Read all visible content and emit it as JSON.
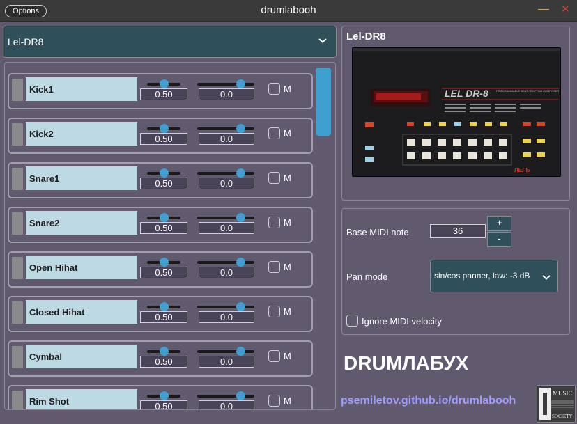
{
  "window": {
    "title": "drumlabooh",
    "options_label": "Options",
    "minimize_glyph": "—",
    "close_glyph": "✕"
  },
  "preset": {
    "selected": "Lel-DR8"
  },
  "drums": [
    {
      "name": "Kick1",
      "level": "0.50",
      "pan": "0.0",
      "mute_label": "M",
      "level_fraction": 0.5,
      "pan_fraction": 0.75
    },
    {
      "name": "Kick2",
      "level": "0.50",
      "pan": "0.0",
      "mute_label": "M",
      "level_fraction": 0.5,
      "pan_fraction": 0.75
    },
    {
      "name": "Snare1",
      "level": "0.50",
      "pan": "0.0",
      "mute_label": "M",
      "level_fraction": 0.5,
      "pan_fraction": 0.75
    },
    {
      "name": "Snare2",
      "level": "0.50",
      "pan": "0.0",
      "mute_label": "M",
      "level_fraction": 0.5,
      "pan_fraction": 0.75
    },
    {
      "name": "Open Hihat",
      "level": "0.50",
      "pan": "0.0",
      "mute_label": "M",
      "level_fraction": 0.5,
      "pan_fraction": 0.75
    },
    {
      "name": "Closed Hihat",
      "level": "0.50",
      "pan": "0.0",
      "mute_label": "M",
      "level_fraction": 0.5,
      "pan_fraction": 0.75
    },
    {
      "name": "Cymbal",
      "level": "0.50",
      "pan": "0.0",
      "mute_label": "M",
      "level_fraction": 0.5,
      "pan_fraction": 0.75
    },
    {
      "name": "Rim Shot",
      "level": "0.50",
      "pan": "0.0",
      "mute_label": "M",
      "level_fraction": 0.5,
      "pan_fraction": 0.75
    }
  ],
  "instrument": {
    "title": "Lel-DR8",
    "device_model": "LEL DR-8",
    "device_subtitle": "PROGRAMMABLE BEAT / RHYTHM COMPOSER",
    "device_brand": "ЛЕЛЬ"
  },
  "settings": {
    "base_midi_label": "Base MIDI note",
    "base_midi_value": "36",
    "plus": "+",
    "minus": "-",
    "pan_mode_label": "Pan mode",
    "pan_mode_value": "sin/cos panner, law: -3 dB",
    "ignore_velocity_label": "Ignore MIDI velocity"
  },
  "brand": "DRUMЛАБУХ",
  "link": "psemiletov.github.io/drumlabooh",
  "logo_text": [
    "MUSIC",
    "SOCIETY"
  ],
  "colors": {
    "background": "#615a6e",
    "accent": "#3fa0d0",
    "link": "#9d9cff",
    "minimize": "#e0a12a",
    "close": "#d1402f"
  }
}
